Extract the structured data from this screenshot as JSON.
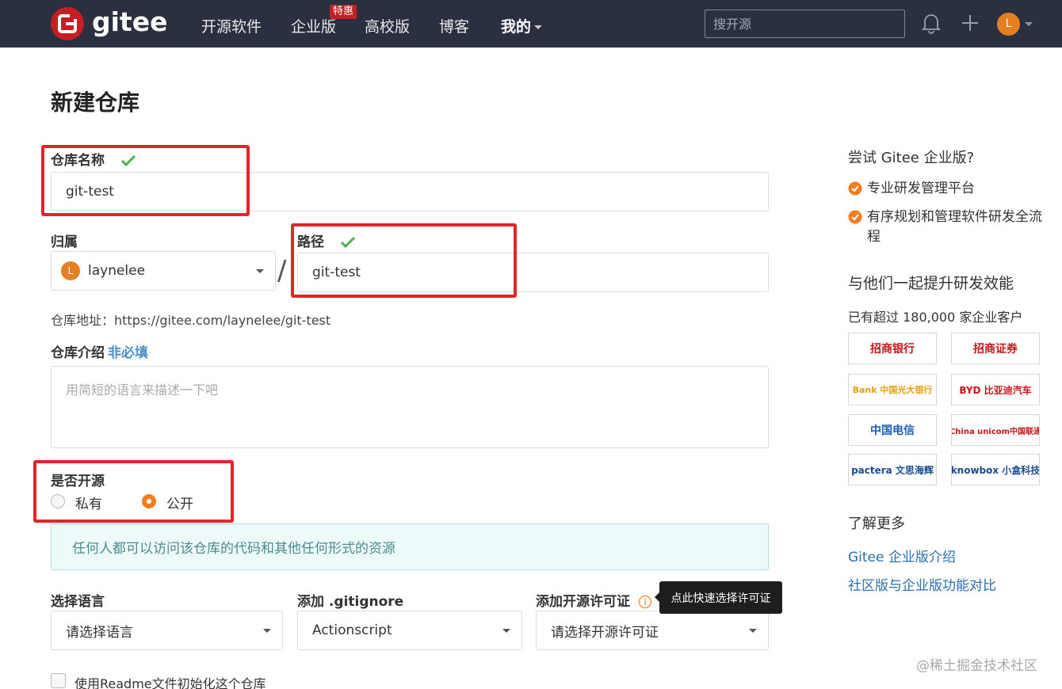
{
  "nav": {
    "brand": "gitee",
    "links": [
      "开源软件",
      "企业版",
      "高校版",
      "博客",
      "我的"
    ],
    "promo_badge": "特惠",
    "search_placeholder": "搜开源",
    "avatar_letter": "L"
  },
  "form": {
    "title": "新建仓库",
    "repo_name_label": "仓库名称",
    "repo_name_value": "git-test",
    "owner_label": "归属",
    "owner_avatar_letter": "L",
    "owner_value": "laynelee",
    "path_label": "路径",
    "path_value": "git-test",
    "address_text": "仓库地址：https://gitee.com/laynelee/git-test",
    "intro_label": "仓库介绍",
    "intro_optional": "非必填",
    "intro_placeholder": "用简短的语言来描述一下吧",
    "open_source_label": "是否开源",
    "visibility_options": [
      "私有",
      "公开"
    ],
    "visibility_selected": "公开",
    "public_notice": "任何人都可以访问该仓库的代码和其他任何形式的资源",
    "language_label": "选择语言",
    "language_value": "请选择语言",
    "gitignore_label": "添加 .gitignore",
    "gitignore_value": "Actionscript",
    "license_label": "添加开源许可证",
    "license_value": "请选择开源许可证",
    "license_tooltip": "点此快速选择许可证",
    "readme_label": "使用Readme文件初始化这个仓库"
  },
  "sidebar": {
    "try_title": "尝试 Gitee 企业版?",
    "features": [
      "专业研发管理平台",
      "有序规划和管理软件研发全流程"
    ],
    "together_title": "与他们一起提升研发效能",
    "customers_text": "已有超过 180,000 家企业客户",
    "logos": [
      "招商银行",
      "招商证券",
      "Bank 中国光大银行",
      "BYD 比亚迪汽车",
      "中国电信",
      "China unicom中国联通",
      "pactera 文思海辉",
      "knowbox 小盒科技"
    ],
    "learn_title": "了解更多",
    "links": [
      "Gitee 企业版介绍",
      "社区版与企业版功能对比"
    ]
  },
  "watermark": "@稀土掘金技术社区",
  "colors": {
    "nav_bg": "#2b3040",
    "brand_red": "#c71d23",
    "accent_orange": "#f57c1f",
    "highlight_red": "#e0252b",
    "success_green": "#4caf50",
    "link_blue": "#2a6fae"
  }
}
